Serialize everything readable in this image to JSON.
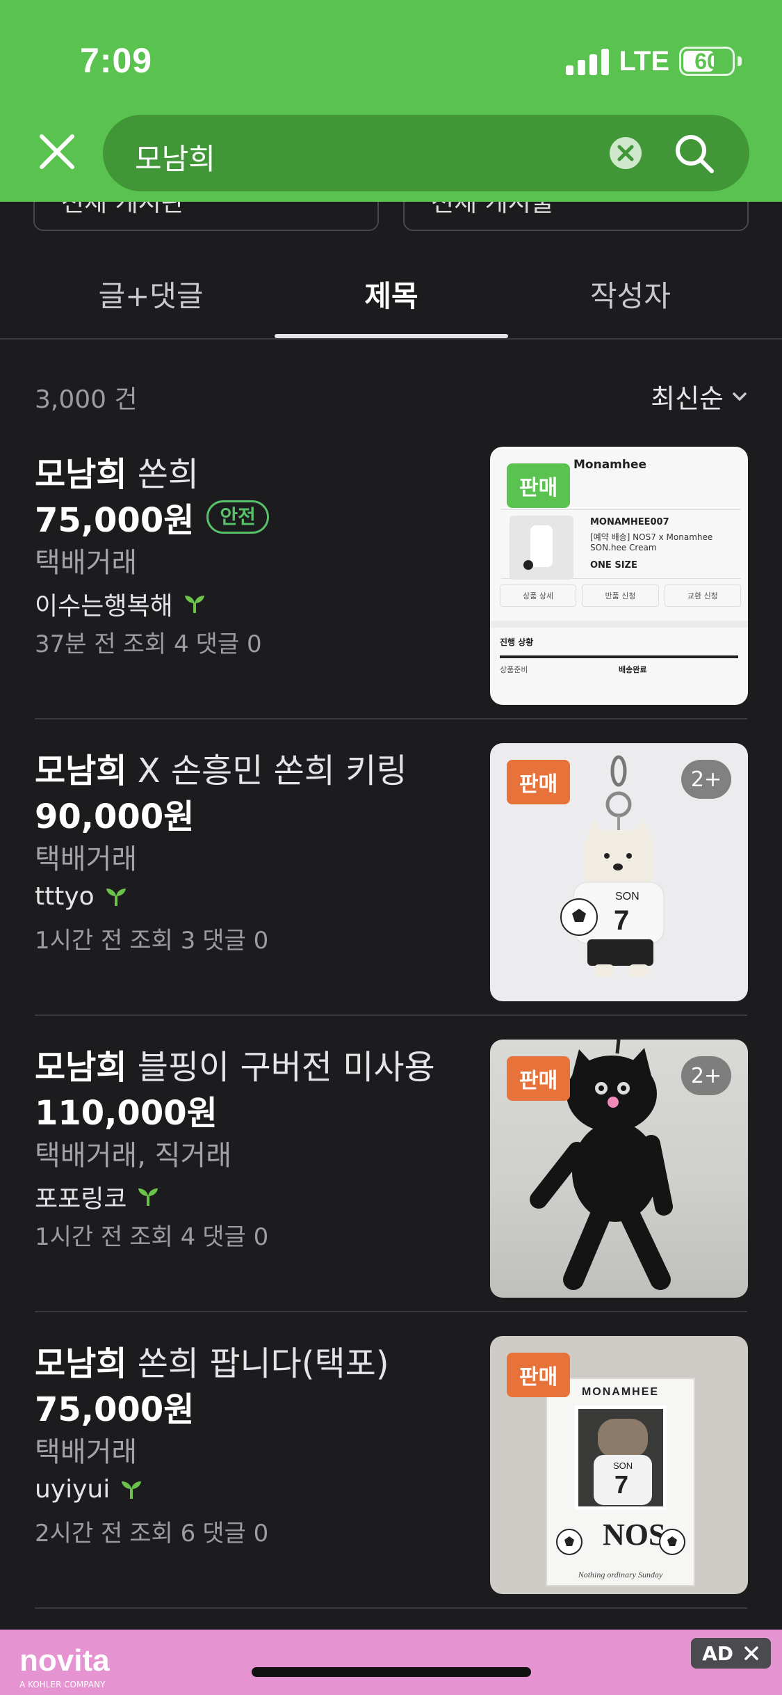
{
  "status": {
    "time": "7:09",
    "network": "LTE",
    "battery": "60"
  },
  "search": {
    "query": "모남희"
  },
  "filters": {
    "board": "전체 게시판",
    "period": "전체 게시물"
  },
  "tabs": [
    {
      "label": "글+댓글"
    },
    {
      "label": "제목"
    },
    {
      "label": "작성자"
    }
  ],
  "active_tab": "제목",
  "results": {
    "count": "3,000 건",
    "sort": "최신순"
  },
  "items": [
    {
      "title_keyword": "모남희",
      "title_rest": " 쏜희",
      "price": "75,000원",
      "safe_badge": "안전",
      "method": "택배거래",
      "seller": "이수는행복해",
      "time": "37분 전",
      "views": "조회 4",
      "comments": "댓글 0",
      "sale_badge": "판매",
      "sale_color": "#5ac24f",
      "thumb": {
        "brand": "Monamhee",
        "code": "MONAMHEE007",
        "line1": "[예약 배송] NOS7 x Monamhee",
        "line2": "SON.hee Cream",
        "size": "ONE SIZE",
        "btn1": "상품 상세",
        "btn2": "반품 신청",
        "btn3": "교환 신청",
        "status_title": "진행 상황",
        "status_left": "상품준비",
        "status_right": "배송완료"
      }
    },
    {
      "title_keyword": "모남희",
      "title_rest": " X 손흥민 쏜희 키링",
      "price": "90,000원",
      "method": "택배거래",
      "seller": "tttyo",
      "time": "1시간 전",
      "views": "조회 3",
      "comments": "댓글 0",
      "sale_badge": "판매",
      "sale_color": "#e8733a",
      "more": "2+"
    },
    {
      "title_keyword": "모남희",
      "title_rest": " 블핑이 구버전 미사용",
      "price": "110,000원",
      "method": "택배거래, 직거래",
      "seller": "포포링코",
      "time": "1시간 전",
      "views": "조회 4",
      "comments": "댓글 0",
      "sale_badge": "판매",
      "sale_color": "#e8733a",
      "more": "2+"
    },
    {
      "title_keyword": "모남희",
      "title_rest": " 쏜희 팝니다(택포)",
      "price": "75,000원",
      "method": "택배거래",
      "seller": "uyiyui",
      "time": "2시간 전",
      "views": "조회 6",
      "comments": "댓글 0",
      "sale_badge": "판매",
      "sale_color": "#e8733a",
      "box": {
        "brand": "MONAMHEE",
        "jersey": "SON",
        "number": "7",
        "logo": "NOS",
        "tagline": "Nothing ordinary Sunday"
      }
    }
  ],
  "ad": {
    "brand": "novita",
    "sub": "A KOHLER COMPANY",
    "label": "AD"
  }
}
